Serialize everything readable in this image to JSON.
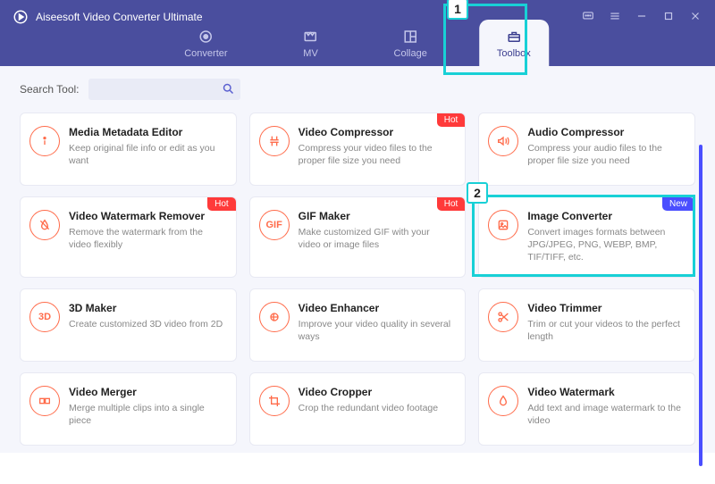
{
  "app": {
    "title": "Aiseesoft Video Converter Ultimate"
  },
  "tabs": {
    "converter": "Converter",
    "mv": "MV",
    "collage": "Collage",
    "toolbox": "Toolbox"
  },
  "search": {
    "label": "Search Tool:",
    "placeholder": ""
  },
  "badges": {
    "hot": "Hot",
    "new": "New"
  },
  "tools": [
    {
      "icon": "info",
      "title": "Media Metadata Editor",
      "desc": "Keep original file info or edit as you want",
      "badge": null
    },
    {
      "icon": "compress",
      "title": "Video Compressor",
      "desc": "Compress your video files to the proper file size you need",
      "badge": "hot"
    },
    {
      "icon": "audio",
      "title": "Audio Compressor",
      "desc": "Compress your audio files to the proper file size you need",
      "badge": null
    },
    {
      "icon": "nowater",
      "title": "Video Watermark Remover",
      "desc": "Remove the watermark from the video flexibly",
      "badge": "hot"
    },
    {
      "icon": "gif",
      "title": "GIF Maker",
      "desc": "Make customized GIF with your video or image files",
      "badge": "hot"
    },
    {
      "icon": "imgconv",
      "title": "Image Converter",
      "desc": "Convert images formats between JPG/JPEG, PNG, WEBP, BMP, TIF/TIFF, etc.",
      "badge": "new"
    },
    {
      "icon": "3d",
      "title": "3D Maker",
      "desc": "Create customized 3D video from 2D",
      "badge": null
    },
    {
      "icon": "enhance",
      "title": "Video Enhancer",
      "desc": "Improve your video quality in several ways",
      "badge": null
    },
    {
      "icon": "trim",
      "title": "Video Trimmer",
      "desc": "Trim or cut your videos to the perfect length",
      "badge": null
    },
    {
      "icon": "merge",
      "title": "Video Merger",
      "desc": "Merge multiple clips into a single piece",
      "badge": null
    },
    {
      "icon": "crop",
      "title": "Video Cropper",
      "desc": "Crop the redundant video footage",
      "badge": null
    },
    {
      "icon": "watermark",
      "title": "Video Watermark",
      "desc": "Add text and image watermark to the video",
      "badge": null
    }
  ],
  "annotations": {
    "step1": "1",
    "step2": "2"
  }
}
